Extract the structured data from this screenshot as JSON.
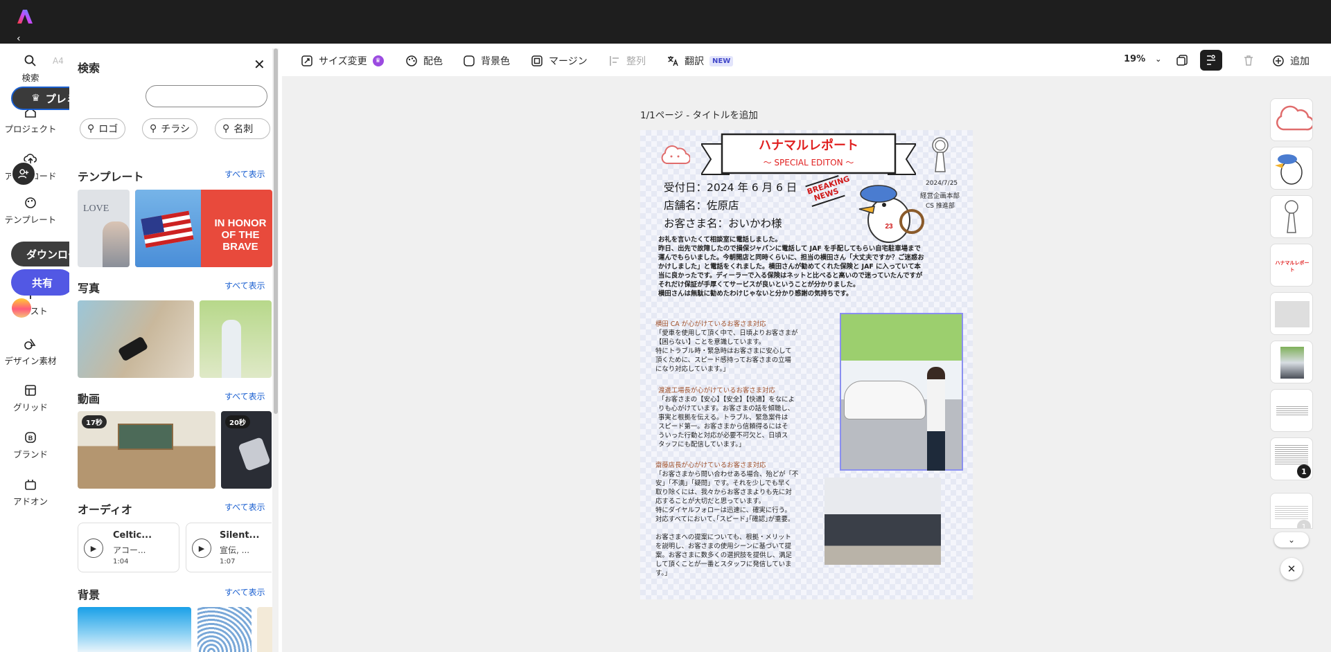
{
  "rail": {
    "items": [
      {
        "label": "検索",
        "icon": "search-icon"
      },
      {
        "label": "プロジェクト",
        "icon": "home-icon"
      },
      {
        "label": "アップロード",
        "icon": "upload-icon"
      },
      {
        "label": "テンプレート",
        "icon": "template-icon"
      },
      {
        "label": "テキスト",
        "icon": "text-icon"
      },
      {
        "label": "デザイン素材",
        "icon": "shapes-icon"
      },
      {
        "label": "グリッド",
        "icon": "grid-icon"
      },
      {
        "label": "ブランド",
        "icon": "brand-icon"
      },
      {
        "label": "アドオン",
        "icon": "addon-icon"
      }
    ],
    "faded_a4": "A4"
  },
  "overlay": {
    "premium": "プレミアムを試す",
    "download": "ダウンロード",
    "share": "共有"
  },
  "panel": {
    "title": "検索",
    "chips": [
      "ロゴ",
      "チラシ",
      "名刺"
    ],
    "see_all": "すべて表示",
    "sections": {
      "templates": "テンプレート",
      "photos": "写真",
      "videos": "動画",
      "audio": "オーディオ",
      "backgrounds": "背景"
    },
    "template_text": {
      "love": "LOVE",
      "honor": "IN HONOR OF THE BRAVE"
    },
    "videos": [
      {
        "duration": "17秒"
      },
      {
        "duration": "20秒"
      }
    ],
    "audio": [
      {
        "title": "Celtic...",
        "sub": "アコー...",
        "time": "1:04"
      },
      {
        "title": "Silent...",
        "sub": "宣伝, ...",
        "time": "1:07"
      }
    ]
  },
  "toolbar": {
    "resize": "サイズ変更",
    "colors": "配色",
    "background": "背景色",
    "margin": "マージン",
    "align": "整列",
    "translate": "翻訳",
    "new_badge": "NEW",
    "zoom": "19%",
    "add": "追加"
  },
  "page_label": "1/1ページ - タイトルを追加",
  "doc": {
    "title": "ハナマルレポート",
    "subtitle": "～ SPECIAL EDITON ～",
    "breaking": "BREAKING NEWS",
    "date": "2024/7/25",
    "dept1": "経営企画本部",
    "dept2": "CS 推進部",
    "info": [
      "受付日：2024 年 6 月 6 日",
      "店舗名：佐原店",
      "お客さま名：おいかわ様"
    ],
    "body": [
      "お礼を言いたくて相談室に電話しました。",
      "昨日、出先で故障したので損保ジャパンに電話して JAF を手配してもらい自宅駐車場まで",
      "運んでもらいました。今朝開店と同時くらいに、担当の横田さん「大丈夫ですか？ご迷惑お",
      "かけしました」と電話をくれました。横田さんが勧めてくれた保険と JAF に入っていて本",
      "当に良かったです。ディーラーで入る保険はネットと比べると高いので迷っていたんですが",
      "それだけ保証が手厚くてサービスが良いということが分かりました。",
      "横田さんは無駄に勧めたわけじゃないと分かり感謝の気持ちです。"
    ],
    "sec1_head": "横田 CA が心がけているお客さま対応",
    "sec1": [
      "「愛車を使用して頂く中で、日頃よりお客さまが",
      "【困らない】ことを意識しています。",
      "特にトラブル時・緊急時はお客さまに安心して",
      "頂くために、スピード感持ってお客さまの立場",
      "になり対応しています。」"
    ],
    "sec2_head": "渡邊工場長が心がけているお客さま対応",
    "sec2": [
      "「お客さまの【安心】【安全】【快適】をなによ",
      "りも心がけています。お客さまの話を傾聴し、",
      "事実と根拠を伝える。トラブル、緊急案件は",
      "スピード第一。お客さまから信頼得るにはそ",
      "ういった行動と対応が必要不可欠と、日頃ス",
      "タッフにも配信しています。」"
    ],
    "sec3_head": "齋藤店長が心がけているお客さま対応",
    "sec3": [
      "「お客さまから問い合わせある場合、殆どが「不",
      "安」「不満」「疑問」です。それを少しでも早く",
      "取り除くには、我々からお客さまよりも先に対",
      "応することが大切だと思っています。",
      "特にダイヤルフォローは迅速に、確実に行う。",
      "対応すべてにおいて､｢スピード｣｢確認｣が重要。",
      "",
      "お客さまへの提案についても、根拠・メリット",
      "を説明し、お客さまの使用シーンに基づいて提",
      "案。お客さまに数多くの選択肢を提供し、満足",
      "して頂くことが一番とスタッフに発信していま",
      "す。」"
    ]
  },
  "thumbs": {
    "badge": "1",
    "mini_title": "ハナマルレポート"
  }
}
